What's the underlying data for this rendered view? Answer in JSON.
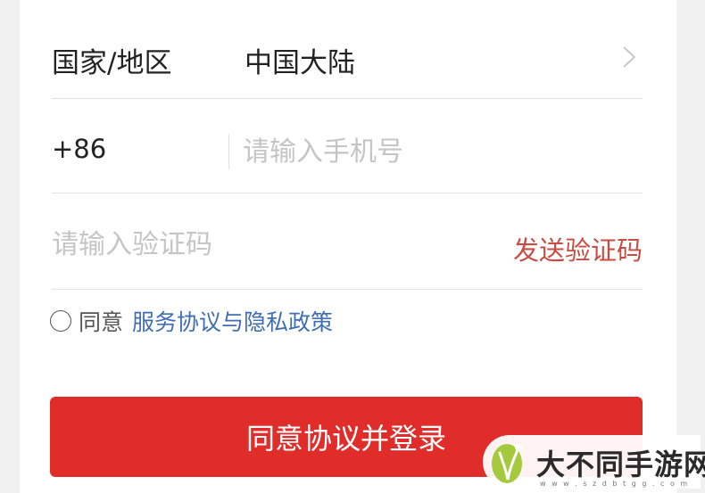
{
  "form": {
    "country_label": "国家/地区",
    "country_value": "中国大陆",
    "phone_prefix": "+86",
    "phone_placeholder": "请输入手机号",
    "code_placeholder": "请输入验证码",
    "send_code_label": "发送验证码",
    "agree_text": "同意",
    "agree_link": "服务协议与隐私政策",
    "submit_label": "同意协议并登录"
  },
  "watermark": {
    "site_name": "大不同手游网",
    "url": "w w w . s z d b t g g . c o m"
  },
  "colors": {
    "accent": "#e02d29",
    "link": "#3f6eb3",
    "send_code": "#c94c42",
    "placeholder": "#c5c5c5"
  }
}
